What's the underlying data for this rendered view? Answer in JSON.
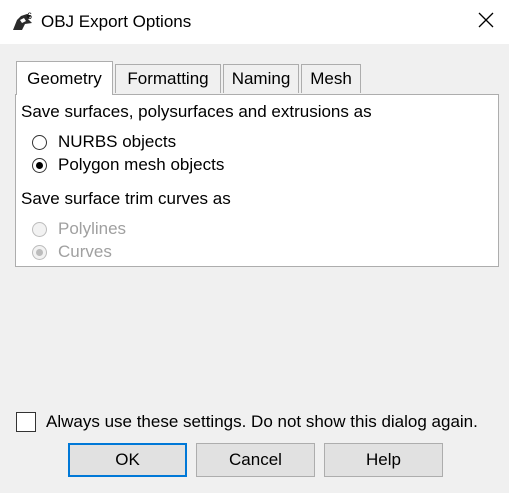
{
  "window": {
    "title": "OBJ Export Options",
    "app_icon": "rhino-icon",
    "close_icon": "close-icon"
  },
  "tabs": [
    {
      "label": "Geometry",
      "active": true
    },
    {
      "label": "Formatting",
      "active": false
    },
    {
      "label": "Naming",
      "active": false
    },
    {
      "label": "Mesh",
      "active": false
    }
  ],
  "geometry": {
    "surfaces_label": "Save surfaces, polysurfaces and extrusions as",
    "surface_options": [
      {
        "label": "NURBS objects",
        "checked": false,
        "enabled": true
      },
      {
        "label": "Polygon mesh objects",
        "checked": true,
        "enabled": true
      }
    ],
    "trim_label": "Save surface trim curves as",
    "trim_options": [
      {
        "label": "Polylines",
        "checked": false,
        "enabled": false
      },
      {
        "label": "Curves",
        "checked": true,
        "enabled": false
      }
    ]
  },
  "footer": {
    "always_use_label": "Always use these settings. Do not show this dialog again.",
    "always_use_checked": false,
    "ok_label": "OK",
    "cancel_label": "Cancel",
    "help_label": "Help"
  },
  "colors": {
    "accent": "#0078d7",
    "dialog_bg": "#f0f0f0",
    "panel_bg": "#ffffff",
    "disabled_text": "#a0a0a0"
  }
}
